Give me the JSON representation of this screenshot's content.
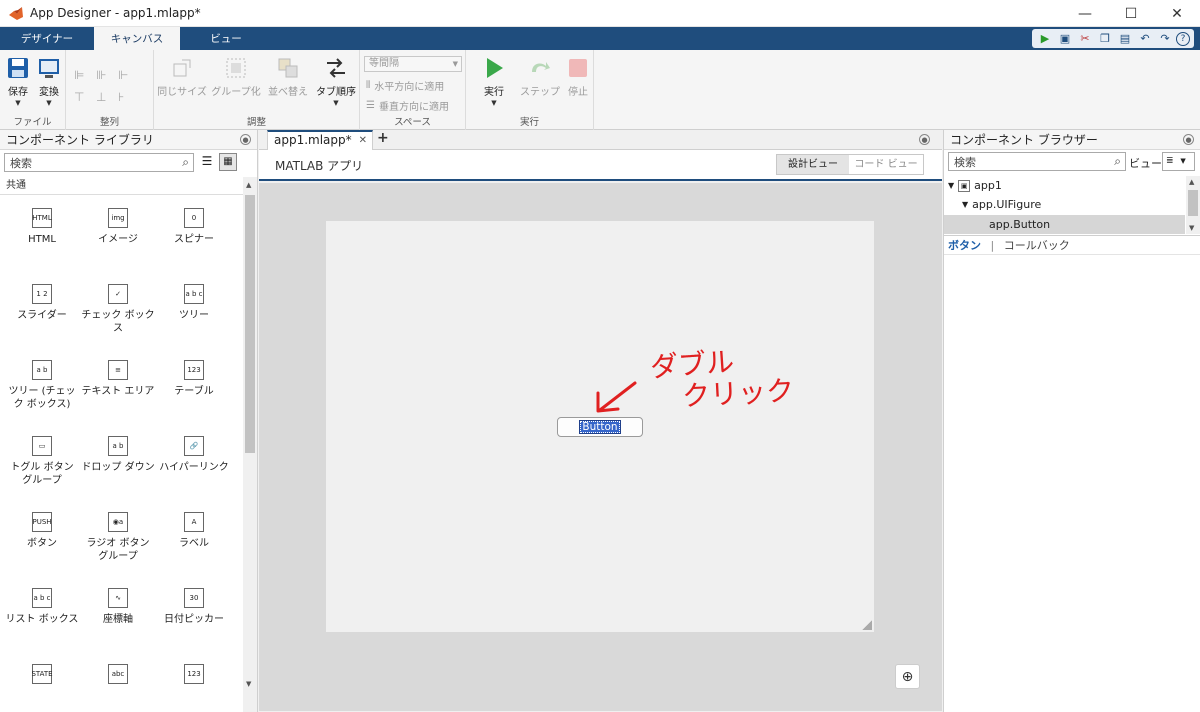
{
  "window": {
    "title": "App Designer - app1.mlapp*"
  },
  "ribbon_tabs": [
    {
      "label": "デザイナー"
    },
    {
      "label": "キャンバス"
    },
    {
      "label": "ビュー"
    }
  ],
  "ribbon": {
    "file": {
      "save": "保存",
      "convert": "変換",
      "group": "ファイル"
    },
    "align": {
      "group": "整列"
    },
    "arrange": {
      "same_size": "同じサイズ",
      "group_btn": "グループ化",
      "reorder": "並べ替え",
      "tab_order": "タブ順序",
      "group": "調整"
    },
    "space": {
      "select": "等間隔",
      "horizontal": "水平方向に適用",
      "vertical": "垂直方向に適用",
      "group": "スペース"
    },
    "run": {
      "run": "実行",
      "step": "ステップ",
      "stop": "停止",
      "group": "実行"
    }
  },
  "library": {
    "title": "コンポーネント ライブラリ",
    "search_placeholder": "検索",
    "section": "共通",
    "items": [
      {
        "label": "HTML",
        "icon": "HTML"
      },
      {
        "label": "イメージ",
        "icon": "img"
      },
      {
        "label": "スピナー",
        "icon": "0"
      },
      {
        "label": "スライダー",
        "icon": "1 2"
      },
      {
        "label": "チェック ボックス",
        "icon": "✓"
      },
      {
        "label": "ツリー",
        "icon": "a b c"
      },
      {
        "label": "ツリー (チェック ボックス)",
        "icon": "a b"
      },
      {
        "label": "テキスト エリア",
        "icon": "≡"
      },
      {
        "label": "テーブル",
        "icon": "123"
      },
      {
        "label": "トグル ボタン グループ",
        "icon": "▭"
      },
      {
        "label": "ドロップ ダウン",
        "icon": "a b"
      },
      {
        "label": "ハイパーリンク",
        "icon": "🔗"
      },
      {
        "label": "ボタン",
        "icon": "PUSH"
      },
      {
        "label": "ラジオ ボタン グループ",
        "icon": "◉a"
      },
      {
        "label": "ラベル",
        "icon": "A"
      },
      {
        "label": "リスト ボックス",
        "icon": "a b c"
      },
      {
        "label": "座標軸",
        "icon": "∿"
      },
      {
        "label": "日付ピッカー",
        "icon": "30"
      },
      {
        "label": "",
        "icon": "STATE"
      },
      {
        "label": "",
        "icon": "abc"
      },
      {
        "label": "",
        "icon": "123"
      }
    ]
  },
  "editor": {
    "tab": "app1.mlapp*",
    "add_tab": "+",
    "header_title": "MATLAB アプリ",
    "design_view": "設計ビュー",
    "code_view": "コード ビュー",
    "button_text": "Button",
    "annotation_line1": "ダブル",
    "annotation_line2": "クリック"
  },
  "browser": {
    "title": "コンポーネント ブラウザー",
    "search_placeholder": "検索",
    "view_label": "ビュー:",
    "tree": [
      "app1",
      "app.UIFigure",
      "app.Button"
    ],
    "inspector_tabs": [
      "ボタン",
      "コールバック"
    ]
  },
  "colors": {
    "accent": "#1f4d7d",
    "annotation": "#e02020",
    "selection": "#3565c9"
  }
}
